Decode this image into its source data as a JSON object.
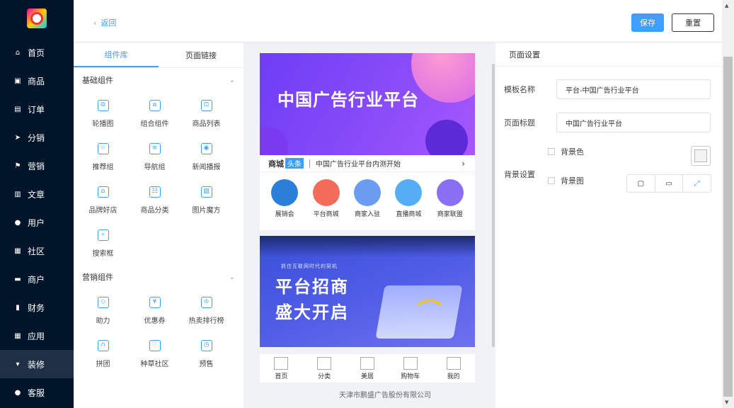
{
  "nav": {
    "items": [
      {
        "label": "首页",
        "icon": "home-icon",
        "glyph": "⌂"
      },
      {
        "label": "商品",
        "icon": "bag-icon",
        "glyph": "▣"
      },
      {
        "label": "订单",
        "icon": "order-icon",
        "glyph": "▤"
      },
      {
        "label": "分销",
        "icon": "send-icon",
        "glyph": "➤"
      },
      {
        "label": "营销",
        "icon": "flag-icon",
        "glyph": "⚑"
      },
      {
        "label": "文章",
        "icon": "article-icon",
        "glyph": "▥"
      },
      {
        "label": "用户",
        "icon": "user-icon",
        "glyph": "●"
      },
      {
        "label": "社区",
        "icon": "community-icon",
        "glyph": "▦"
      },
      {
        "label": "商户",
        "icon": "store-icon",
        "glyph": "▬"
      },
      {
        "label": "财务",
        "icon": "chart-icon",
        "glyph": "▮"
      },
      {
        "label": "应用",
        "icon": "apps-icon",
        "glyph": "▦"
      },
      {
        "label": "装修",
        "icon": "brush-icon",
        "glyph": "▾"
      },
      {
        "label": "客服",
        "icon": "service-icon",
        "glyph": "●"
      }
    ],
    "active": "装修"
  },
  "header": {
    "back_label": "返回",
    "save_label": "保存",
    "reset_label": "重置"
  },
  "library": {
    "tabs": [
      "组件库",
      "页面链接"
    ],
    "basic_title": "基础组件",
    "basic": [
      {
        "label": "轮播图",
        "icon": "carousel-icon",
        "glyph": "⧉"
      },
      {
        "label": "组合组件",
        "icon": "combine-icon",
        "glyph": "⧈"
      },
      {
        "label": "商品列表",
        "icon": "product-list-icon",
        "glyph": "⊡"
      },
      {
        "label": "推荐组",
        "icon": "star-icon",
        "glyph": "☆"
      },
      {
        "label": "导航组",
        "icon": "nav-group-icon",
        "glyph": "≡"
      },
      {
        "label": "新闻播报",
        "icon": "broadcast-icon",
        "glyph": "◉"
      },
      {
        "label": "品牌好店",
        "icon": "shop-icon",
        "glyph": "⌂"
      },
      {
        "label": "商品分类",
        "icon": "category-icon",
        "glyph": "☷"
      },
      {
        "label": "图片魔方",
        "icon": "image-cube-icon",
        "glyph": "▨"
      },
      {
        "label": "搜索框",
        "icon": "search-icon",
        "glyph": "⌕"
      }
    ],
    "marketing_title": "营销组件",
    "marketing": [
      {
        "label": "助力",
        "icon": "boost-icon",
        "glyph": "◇"
      },
      {
        "label": "优惠券",
        "icon": "coupon-icon",
        "glyph": "¥"
      },
      {
        "label": "热卖排行榜",
        "icon": "trophy-icon",
        "glyph": "♔"
      },
      {
        "label": "拼团",
        "icon": "group-buy-icon",
        "glyph": "∩"
      },
      {
        "label": "种草社区",
        "icon": "heart-icon",
        "glyph": "♡"
      },
      {
        "label": "预售",
        "icon": "clock-icon",
        "glyph": "◷"
      },
      {
        "label": "",
        "icon": "alarm-icon",
        "glyph": "⏰"
      },
      {
        "label": "",
        "icon": "note-icon",
        "glyph": "✎"
      },
      {
        "label": "",
        "icon": "live-icon",
        "glyph": "▷"
      }
    ]
  },
  "preview": {
    "banner_title": "中国广告行业平台",
    "news_tag1": "商城",
    "news_tag2": "头条",
    "news_text": "中国广告行业平台内测开始",
    "icons": [
      {
        "label": "展销会",
        "color": "#2b7fd8"
      },
      {
        "label": "平台商城",
        "color": "#f36b5a"
      },
      {
        "label": "商家入驻",
        "color": "#6b9cf2"
      },
      {
        "label": "直播商城",
        "color": "#55aef5"
      },
      {
        "label": "商家联盟",
        "color": "#8a6ff2"
      }
    ],
    "banner2_small": "抓住互联网时代的契机",
    "banner2_line1": "平台招商",
    "banner2_line2": "盛大开启",
    "tabbar": [
      "首页",
      "分类",
      "美居",
      "购物车",
      "我的"
    ]
  },
  "footer": "天津市鹏盛广告股份有限公司",
  "settings": {
    "title": "页面设置",
    "template_label": "模板名称",
    "template_value": "平台-中国广告行业平台",
    "page_title_label": "页面标题",
    "page_title_value": "中国广告行业平台",
    "bg_label": "背景设置",
    "bg_color": "背景色",
    "bg_image": "背景图"
  }
}
